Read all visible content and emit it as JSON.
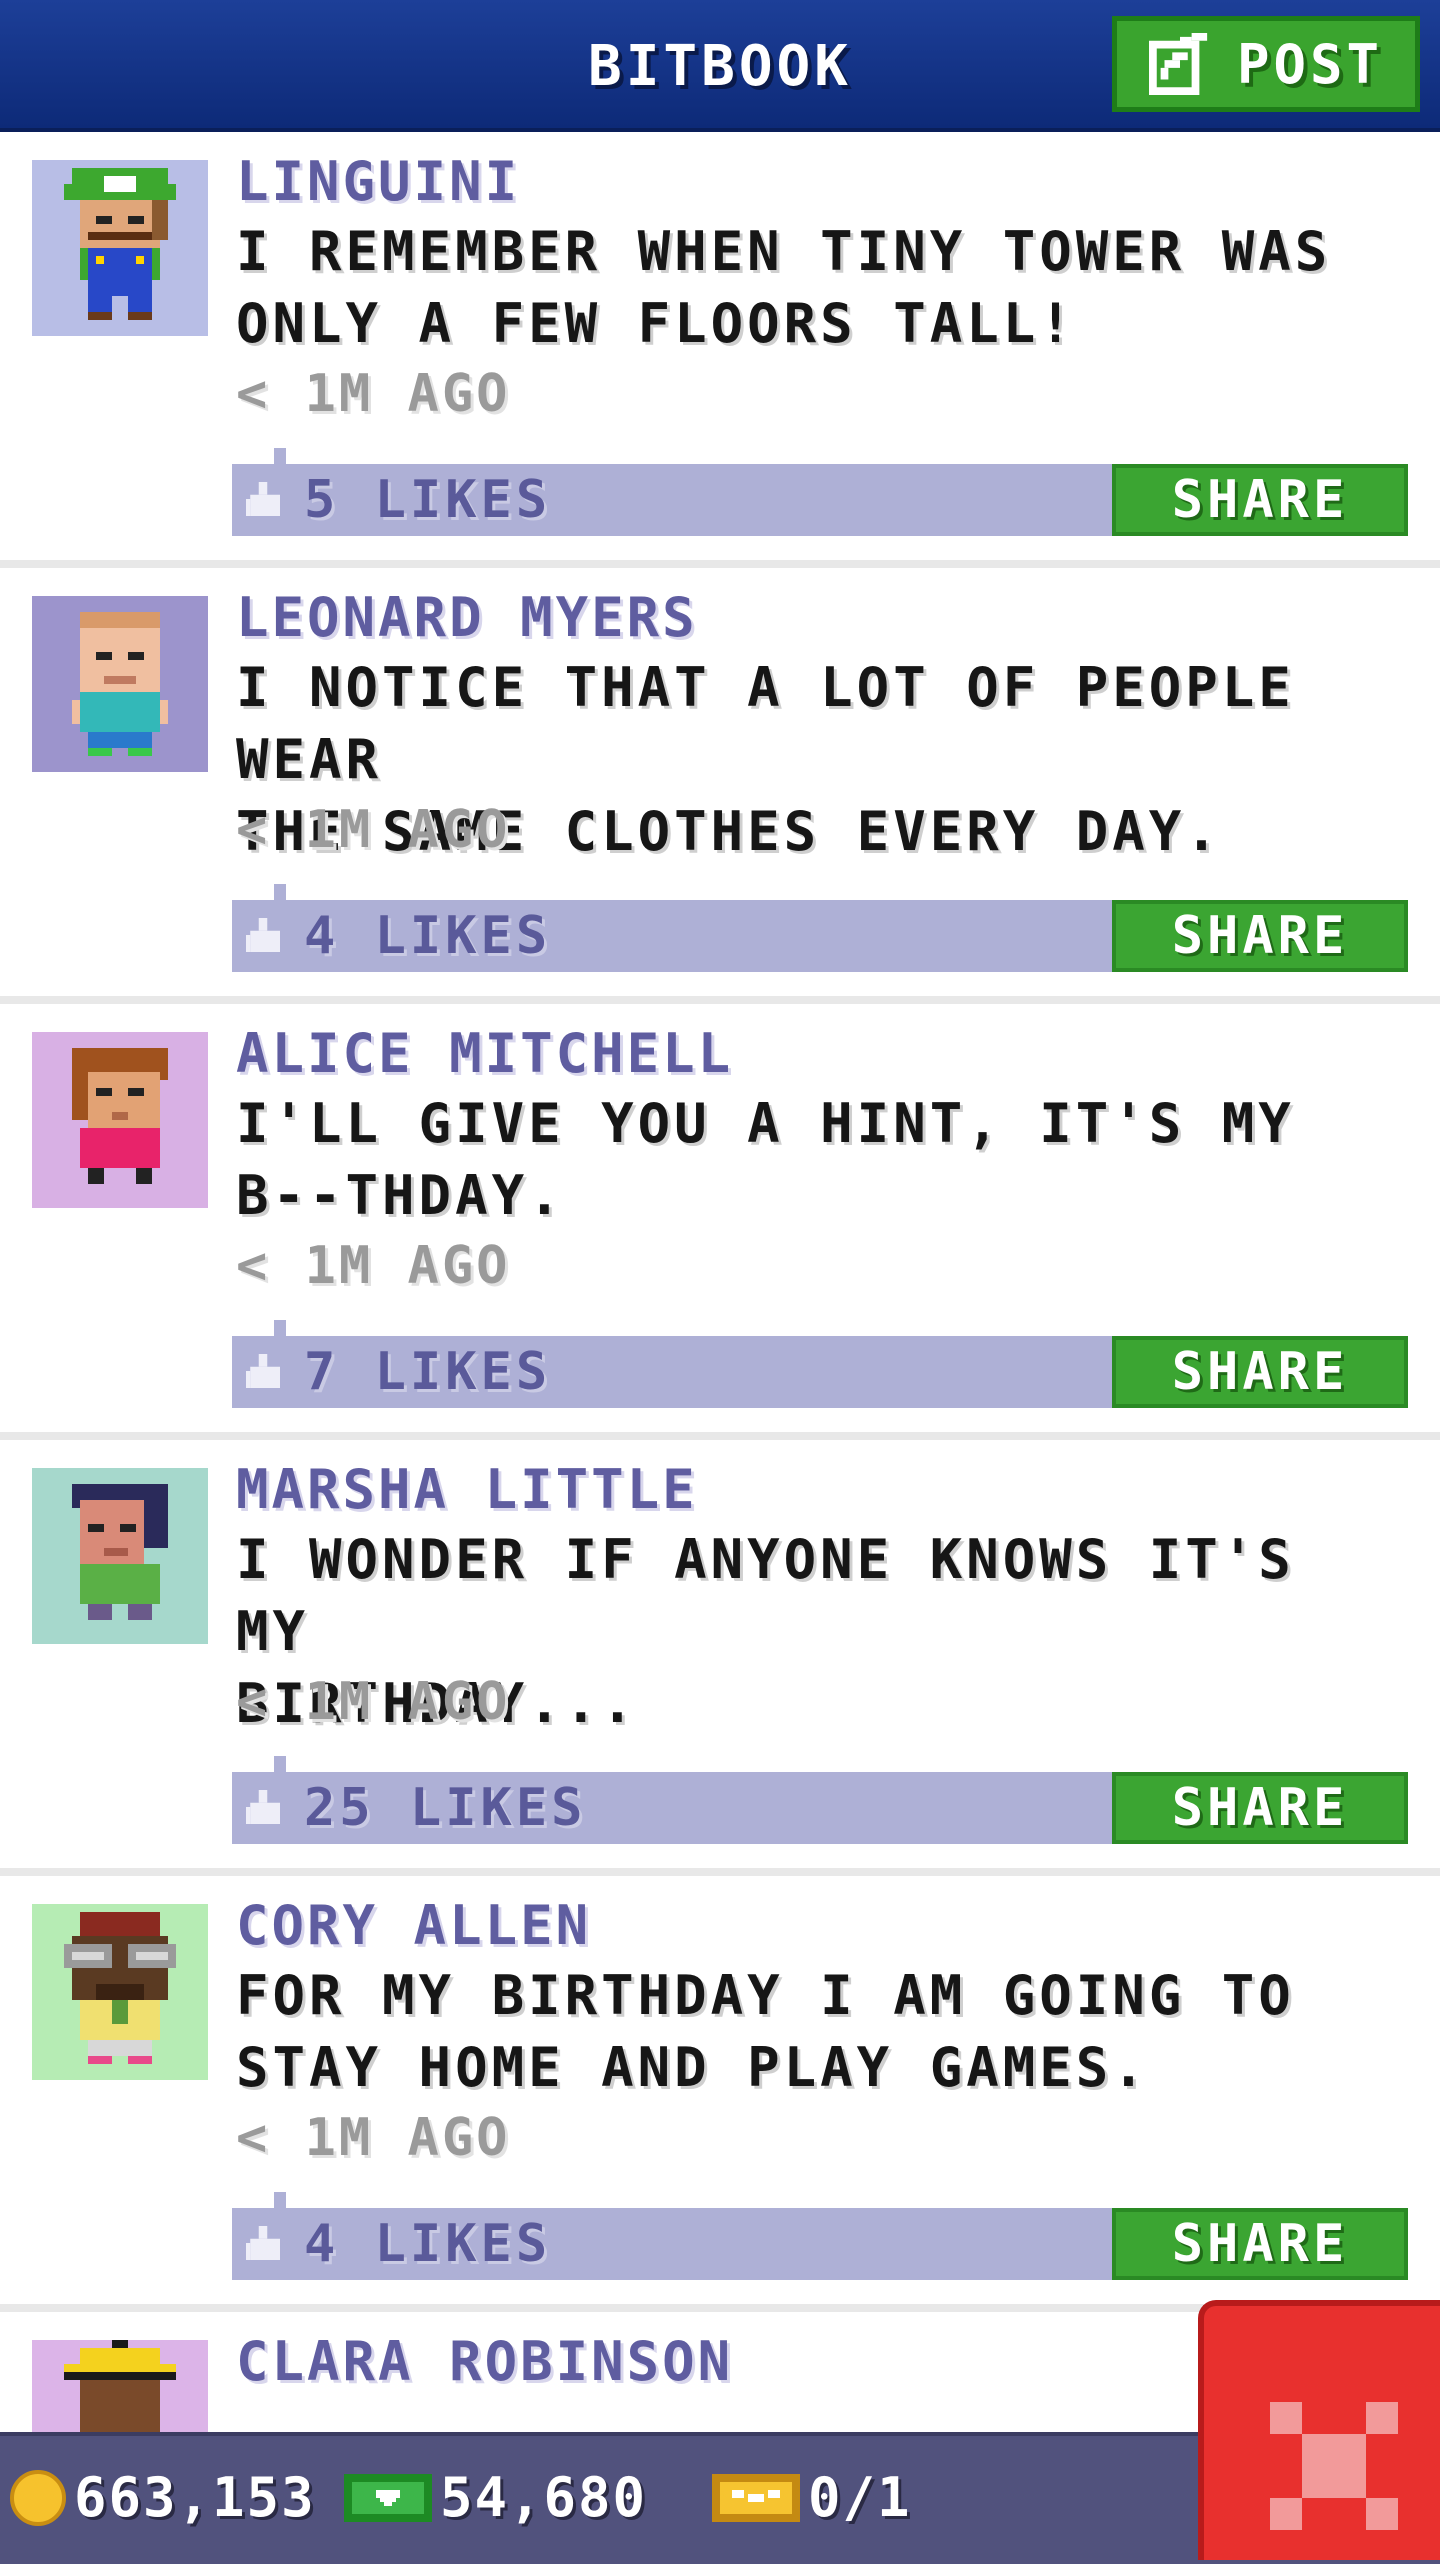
{
  "header": {
    "title": "BITBOOK",
    "post_label": "POST"
  },
  "posts": [
    {
      "author": "LINGUINI",
      "line1": "I REMEMBER WHEN TINY TOWER WAS",
      "line2": "ONLY A FEW FLOORS TALL!",
      "time": "< 1M AGO",
      "likes": "5 LIKES",
      "share_label": "SHARE",
      "avatar_bg": "#b8bee6"
    },
    {
      "author": "LEONARD MYERS",
      "line1": "I NOTICE THAT A LOT OF PEOPLE WEAR",
      "line2": "THE SAME CLOTHES EVERY DAY.",
      "time": "< 1M AGO",
      "likes": "4 LIKES",
      "share_label": "SHARE",
      "avatar_bg": "#9c94cc"
    },
    {
      "author": "ALICE MITCHELL",
      "line1": "I'LL GIVE YOU A HINT, IT'S MY",
      "line2": "B--THDAY.",
      "time": "< 1M AGO",
      "likes": "7 LIKES",
      "share_label": "SHARE",
      "avatar_bg": "#d8b0e4"
    },
    {
      "author": "MARSHA LITTLE",
      "line1": "I WONDER IF ANYONE KNOWS IT'S MY",
      "line2": "BIRTHDAY...",
      "time": "< 1M AGO",
      "likes": "25 LIKES",
      "share_label": "SHARE",
      "avatar_bg": "#a6d8cc"
    },
    {
      "author": "CORY ALLEN",
      "line1": "FOR MY BIRTHDAY I AM GOING TO",
      "line2": "STAY HOME AND PLAY GAMES.",
      "time": "< 1M AGO",
      "likes": "4 LIKES",
      "share_label": "SHARE",
      "avatar_bg": "#b6ecb4"
    }
  ],
  "partial_post": {
    "author": "CLARA ROBINSON",
    "avatar_bg": "#dcb4e8"
  },
  "resources": {
    "coins": "663,153",
    "bux": "54,680",
    "tickets": "0/1"
  },
  "colors": {
    "header_blue": "#1d3f98",
    "share_green": "#3ba532",
    "likes_bar": "#aeb0d6",
    "close_red": "#e8302e"
  }
}
